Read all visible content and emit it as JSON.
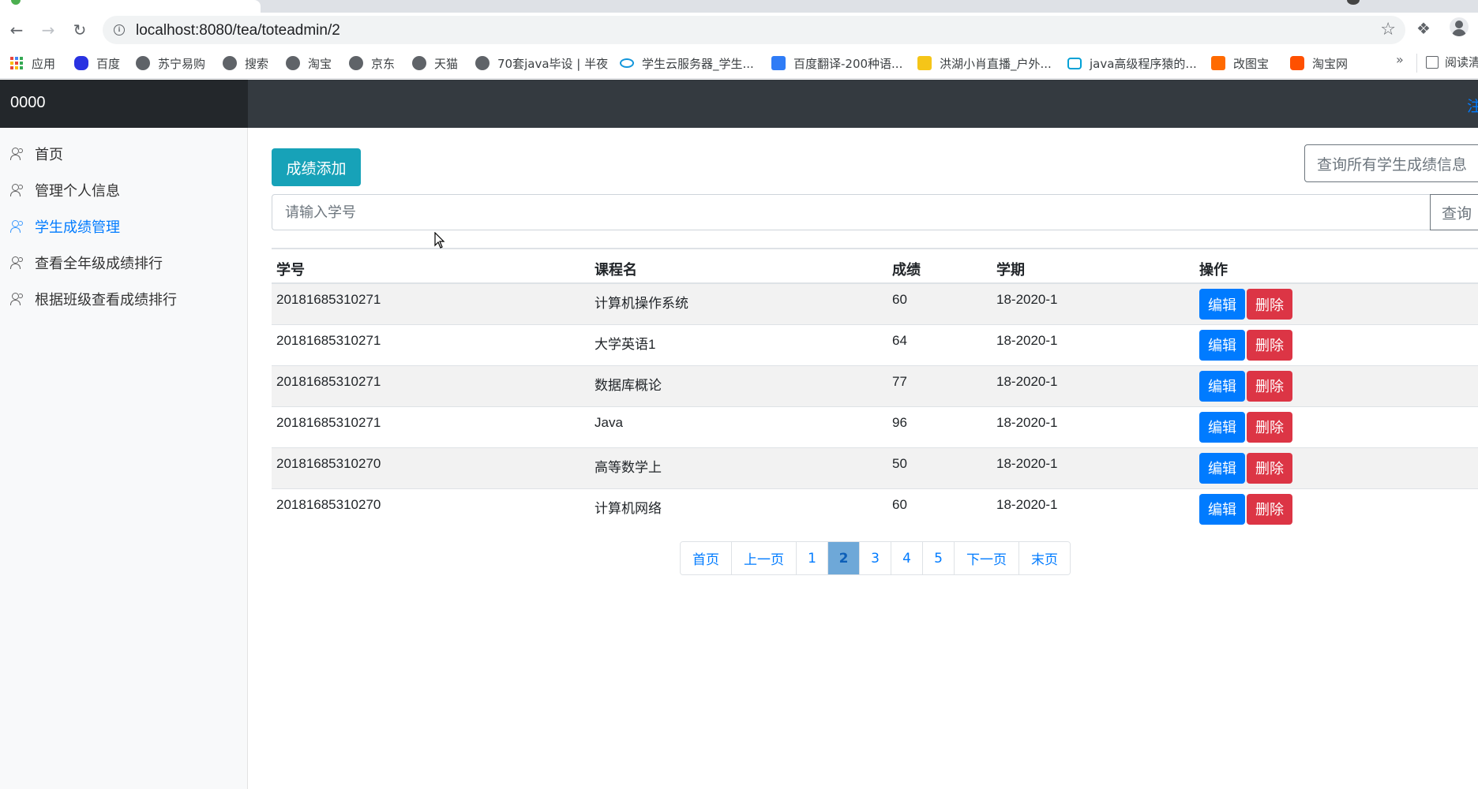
{
  "browser": {
    "url": "localhost:8080/tea/toteadmin/2",
    "bookmarks": [
      {
        "label": "应用",
        "icon": "apps-grid-icon"
      },
      {
        "label": "百度",
        "icon": "baidu-paw-icon"
      },
      {
        "label": "苏宁易购",
        "icon": "globe-icon"
      },
      {
        "label": "搜索",
        "icon": "globe-icon"
      },
      {
        "label": "淘宝",
        "icon": "globe-icon"
      },
      {
        "label": "京东",
        "icon": "globe-icon"
      },
      {
        "label": "天猫",
        "icon": "globe-icon"
      },
      {
        "label": "70套java毕设 | 半夜",
        "icon": "globe-icon"
      },
      {
        "label": "学生云服务器_学生...",
        "icon": "cloud-icon"
      },
      {
        "label": "百度翻译-200种语...",
        "icon": "translate-icon"
      },
      {
        "label": "洪湖小肖直播_户外...",
        "icon": "fishhook-icon"
      },
      {
        "label": "java高级程序猿的...",
        "icon": "bilibili-icon"
      },
      {
        "label": "改图宝",
        "icon": "gaitubao-icon"
      },
      {
        "label": "淘宝网",
        "icon": "taobao-icon"
      }
    ],
    "more_label": "»",
    "reading_list": "阅读清"
  },
  "app": {
    "brand": "0000",
    "signout": "注"
  },
  "sidebar": {
    "items": [
      {
        "label": "首页",
        "active": false
      },
      {
        "label": "管理个人信息",
        "active": false
      },
      {
        "label": "学生成绩管理",
        "active": true
      },
      {
        "label": "查看全年级成绩排行",
        "active": false
      },
      {
        "label": "根据班级查看成绩排行",
        "active": false
      }
    ]
  },
  "main": {
    "add_button": "成绩添加",
    "query_all_button": "查询所有学生成绩信息",
    "search_placeholder": "请输入学号",
    "query_button": "查询",
    "columns": [
      "学号",
      "课程名",
      "成绩",
      "学期",
      "操作"
    ],
    "rows": [
      {
        "id": "20181685310271",
        "course": "计算机操作系统",
        "score": "60",
        "term": "18-2020-1"
      },
      {
        "id": "20181685310271",
        "course": "大学英语1",
        "score": "64",
        "term": "18-2020-1"
      },
      {
        "id": "20181685310271",
        "course": "数据库概论",
        "score": "77",
        "term": "18-2020-1"
      },
      {
        "id": "20181685310271",
        "course": "Java",
        "score": "96",
        "term": "18-2020-1"
      },
      {
        "id": "20181685310270",
        "course": "高等数学上",
        "score": "50",
        "term": "18-2020-1"
      },
      {
        "id": "20181685310270",
        "course": "计算机网络",
        "score": "60",
        "term": "18-2020-1"
      }
    ],
    "edit_label": "编辑",
    "delete_label": "删除",
    "pagination": {
      "first": "首页",
      "prev": "上一页",
      "pages": [
        "1",
        "2",
        "3",
        "4",
        "5"
      ],
      "current": "2",
      "next": "下一页",
      "last": "末页"
    }
  },
  "colors": {
    "navbar": "#343a40",
    "brand_bg": "#23272b",
    "add_button": "#17a2b8",
    "edit_button": "#007bff",
    "delete_button": "#dc3545",
    "link": "#007bff"
  }
}
